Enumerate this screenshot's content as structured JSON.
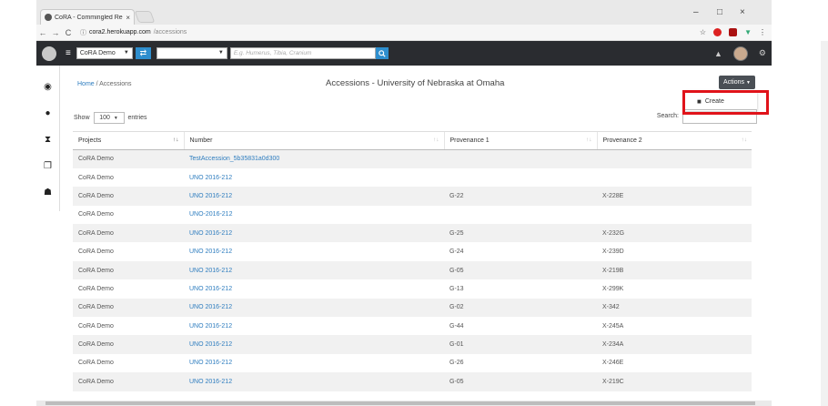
{
  "browser": {
    "tab_title": "CoRA - Commingled Re...",
    "tab_close": "×",
    "url_host": "cora2.herokuapp.com",
    "url_path": "/accessions",
    "min": "–",
    "max": "□",
    "close": "×"
  },
  "navbar": {
    "project_select": "CoRA Demo",
    "search_placeholder": "E.g. Humerus, Tibia, Cranium",
    "swap_icon": "⇄",
    "search_icon": "🔍"
  },
  "page": {
    "breadcrumb_home": "Home",
    "breadcrumb_sep": " / ",
    "breadcrumb_current": "Accessions",
    "title": "Accessions - University of Nebraska at Omaha",
    "actions_label": "Actions",
    "dropdown_create": "Create"
  },
  "controls": {
    "show_label": "Show",
    "entries_value": "100",
    "entries_label": "entries",
    "search_label": "Search:"
  },
  "table": {
    "headers": [
      "Projects",
      "Number",
      "Provenance 1",
      "Provenance 2"
    ],
    "rows": [
      [
        "CoRA Demo",
        "TestAccession_5b35831a0d300",
        "",
        ""
      ],
      [
        "CoRA Demo",
        "UNO 2016-212",
        "",
        ""
      ],
      [
        "CoRA Demo",
        "UNO 2016-212",
        "G-22",
        "X-228E"
      ],
      [
        "CoRA Demo",
        "UNO-2016-212",
        "",
        ""
      ],
      [
        "CoRA Demo",
        "UNO 2016-212",
        "G-25",
        "X-232G"
      ],
      [
        "CoRA Demo",
        "UNO 2016-212",
        "G-24",
        "X-239D"
      ],
      [
        "CoRA Demo",
        "UNO 2016-212",
        "G-05",
        "X-219B"
      ],
      [
        "CoRA Demo",
        "UNO 2016-212",
        "G-13",
        "X-299K"
      ],
      [
        "CoRA Demo",
        "UNO 2016-212",
        "G-02",
        "X-342"
      ],
      [
        "CoRA Demo",
        "UNO 2016-212",
        "G-44",
        "X-245A"
      ],
      [
        "CoRA Demo",
        "UNO 2016-212",
        "G-01",
        "X-234A"
      ],
      [
        "CoRA Demo",
        "UNO 2016-212",
        "G-26",
        "X-246E"
      ],
      [
        "CoRA Demo",
        "UNO 2016-212",
        "G-05",
        "X-219C"
      ]
    ]
  }
}
